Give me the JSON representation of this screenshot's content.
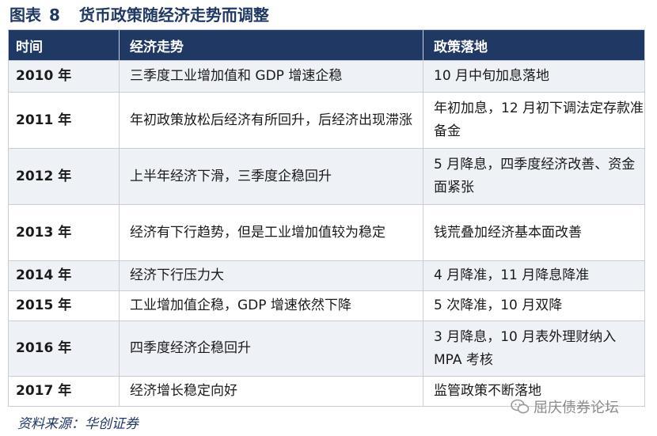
{
  "title": {
    "prefix": "图表",
    "number": "8",
    "text": "货币政策随经济走势而调整"
  },
  "columns": [
    "时间",
    "经济走势",
    "政策落地"
  ],
  "rows": [
    {
      "year": "2010 年",
      "economy": "三季度工业增加值和 GDP 增速企稳",
      "policy": "10 月中旬加息落地"
    },
    {
      "year": "2011 年",
      "economy": "年初政策放松后经济有所回升，后经济出现滞涨",
      "policy": "年初加息，12 月初下调法定存款准备金"
    },
    {
      "year": "2012 年",
      "economy": "上半年经济下滑，三季度企稳回升",
      "policy": "5 月降息，四季度经济改善、资金面紧张"
    },
    {
      "year": "2013 年",
      "economy": "经济有下行趋势，但是工业增加值较为稳定",
      "policy": "钱荒叠加经济基本面改善"
    },
    {
      "year": "2014 年",
      "economy": "经济下行压力大",
      "policy": "4 月降准，11 月降息降准"
    },
    {
      "year": "2015 年",
      "economy": "工业增加值企稳，GDP 增速依然下降",
      "policy": "5 次降准，10 月双降"
    },
    {
      "year": "2016 年",
      "economy": "四季度经济企稳回升",
      "policy": "3 月降息，10 月表外理财纳入 MPA 考核"
    },
    {
      "year": "2017 年",
      "economy": "经济增长稳定向好",
      "policy": "监管政策不断落地"
    }
  ],
  "source": "资料来源：华创证券",
  "watermark": {
    "text": "屈庆债券论坛",
    "icon": "wechat-icon"
  }
}
